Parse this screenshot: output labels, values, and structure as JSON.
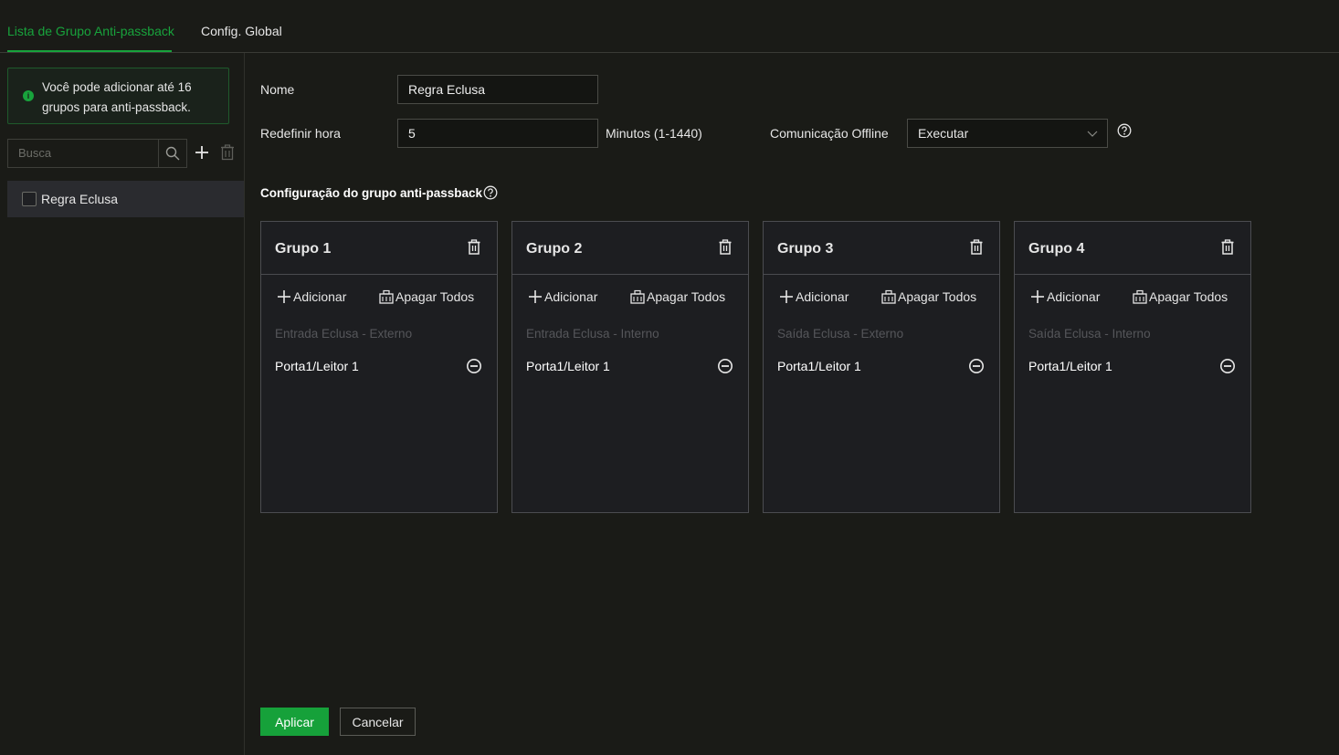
{
  "tabs": [
    {
      "label": "Lista de Grupo Anti-passback",
      "active": true
    },
    {
      "label": "Config. Global",
      "active": false
    }
  ],
  "accent_color": "#18a33c",
  "sidebar": {
    "notice": "Você pode adicionar até 16 grupos para anti-passback.",
    "search_placeholder": "Busca",
    "rules": [
      {
        "label": "Regra Eclusa",
        "checked": false
      }
    ]
  },
  "form": {
    "name_label": "Nome",
    "name_value": "Regra Eclusa",
    "reset_label": "Redefinir hora",
    "reset_value": "5",
    "reset_unit": "Minutos (1-1440)",
    "offline_label": "Comunicação Offline",
    "offline_value": "Executar"
  },
  "section_title": "Configuração do grupo anti-passback",
  "groups": [
    {
      "title": "Grupo 1",
      "add_label": "Adicionar",
      "clear_label": "Apagar Todos",
      "subtitle": "Entrada Eclusa - Externo",
      "member": "Porta1/Leitor 1"
    },
    {
      "title": "Grupo 2",
      "add_label": "Adicionar",
      "clear_label": "Apagar Todos",
      "subtitle": "Entrada Eclusa - Interno",
      "member": "Porta1/Leitor 1"
    },
    {
      "title": "Grupo 3",
      "add_label": "Adicionar",
      "clear_label": "Apagar Todos",
      "subtitle": "Saída Eclusa - Externo",
      "member": "Porta1/Leitor 1"
    },
    {
      "title": "Grupo 4",
      "add_label": "Adicionar",
      "clear_label": "Apagar Todos",
      "subtitle": "Saída Eclusa - Interno",
      "member": "Porta1/Leitor 1"
    }
  ],
  "buttons": {
    "apply": "Aplicar",
    "cancel": "Cancelar"
  }
}
